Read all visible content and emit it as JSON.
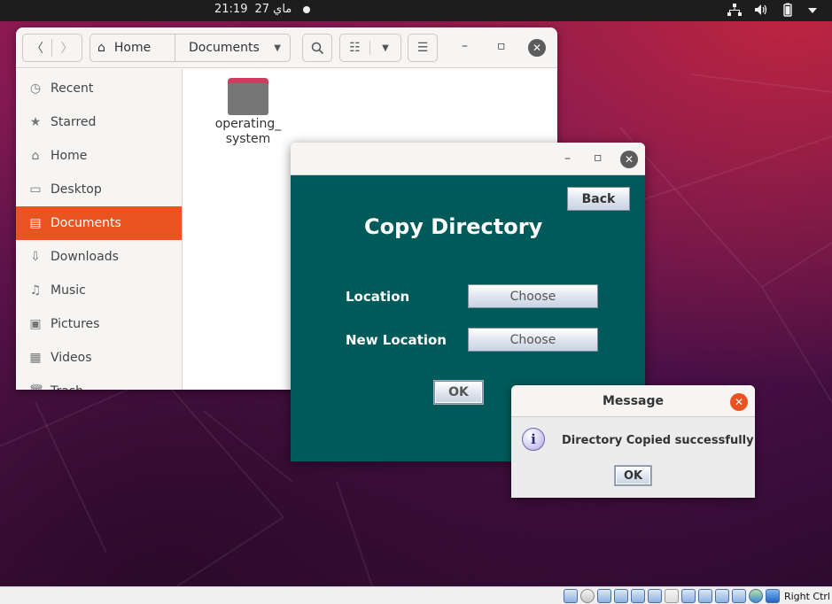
{
  "topbar": {
    "clock_time": "21:19",
    "clock_date": "27 ماي",
    "network_icon": "network-icon",
    "volume_icon": "volume-icon",
    "battery_icon": "battery-icon",
    "menu_icon": "chevron-down-icon"
  },
  "files": {
    "path_home": "Home",
    "path_current": "Documents",
    "sidebar": [
      {
        "label": "Recent",
        "icon": "clock-icon",
        "glyph": "◷"
      },
      {
        "label": "Starred",
        "icon": "star-icon",
        "glyph": "★"
      },
      {
        "label": "Home",
        "icon": "home-icon",
        "glyph": "⌂"
      },
      {
        "label": "Desktop",
        "icon": "desktop-icon",
        "glyph": "▭"
      },
      {
        "label": "Documents",
        "icon": "document-icon",
        "glyph": "▤"
      },
      {
        "label": "Downloads",
        "icon": "download-icon",
        "glyph": "⇩"
      },
      {
        "label": "Music",
        "icon": "music-icon",
        "glyph": "♫"
      },
      {
        "label": "Pictures",
        "icon": "picture-icon",
        "glyph": "▣"
      },
      {
        "label": "Videos",
        "icon": "video-icon",
        "glyph": "▦"
      },
      {
        "label": "Trash",
        "icon": "trash-icon",
        "glyph": "🗑"
      }
    ],
    "active_item": "Documents",
    "folder_name_line1": "operating_",
    "folder_name_line2": "system"
  },
  "app": {
    "back_label": "Back",
    "heading": "Copy Directory",
    "location_label": "Location",
    "location_button": "Choose",
    "new_location_label": "New Location",
    "new_location_button": "Choose",
    "ok_label": "OK"
  },
  "message": {
    "title": "Message",
    "text": "Directory Copied successfully",
    "ok_label": "OK"
  },
  "bottombar": {
    "host_key": "Right Ctrl"
  },
  "colors": {
    "accent": "#e95420",
    "app_background": "#005a5a"
  }
}
